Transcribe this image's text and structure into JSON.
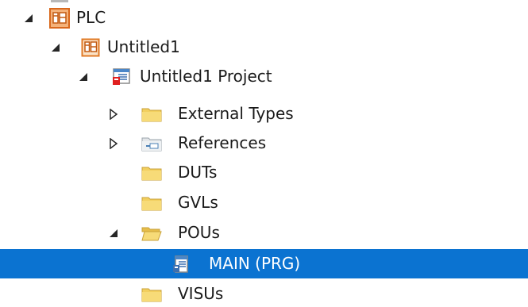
{
  "tree": {
    "nodes": [
      {
        "label": "PLC",
        "expander": "expanded",
        "icon": "plc-icon"
      },
      {
        "label": "Untitled1",
        "expander": "expanded",
        "icon": "plc-project-icon"
      },
      {
        "label": "Untitled1 Project",
        "expander": "expanded",
        "icon": "project-icon"
      },
      {
        "label": "External Types",
        "expander": "collapsed",
        "icon": "folder-icon"
      },
      {
        "label": "References",
        "expander": "collapsed",
        "icon": "references-icon"
      },
      {
        "label": "DUTs",
        "expander": "none",
        "icon": "folder-icon"
      },
      {
        "label": "GVLs",
        "expander": "none",
        "icon": "folder-icon"
      },
      {
        "label": "POUs",
        "expander": "expanded",
        "icon": "folder-open-icon"
      },
      {
        "label": "MAIN (PRG)",
        "expander": "none",
        "icon": "program-icon",
        "selected": true
      },
      {
        "label": "VISUs",
        "expander": "none",
        "icon": "folder-icon"
      }
    ]
  },
  "colors": {
    "selection": "#0b73d1",
    "folder": "#f2cf5f",
    "plc_orange": "#e8832a"
  }
}
